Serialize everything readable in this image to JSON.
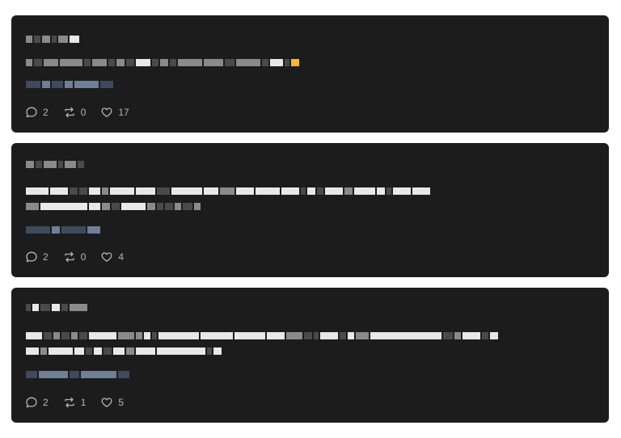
{
  "posts": [
    {
      "stats": {
        "replies": "2",
        "reposts": "0",
        "likes": "17"
      },
      "icons": [
        "reply-icon",
        "repost-icon",
        "like-icon"
      ]
    },
    {
      "stats": {
        "replies": "2",
        "reposts": "0",
        "likes": "4"
      },
      "icons": [
        "reply-icon",
        "repost-icon",
        "like-icon"
      ]
    },
    {
      "stats": {
        "replies": "2",
        "reposts": "1",
        "likes": "5"
      },
      "icons": [
        "reply-icon",
        "repost-icon",
        "like-icon"
      ]
    }
  ],
  "colors": {
    "page_bg": "#ffffff",
    "card_bg": "#1c1c1c",
    "stat_text": "#b5b5b5",
    "link_text": "#6e7f99",
    "emoji_accent": "#f6b733"
  }
}
